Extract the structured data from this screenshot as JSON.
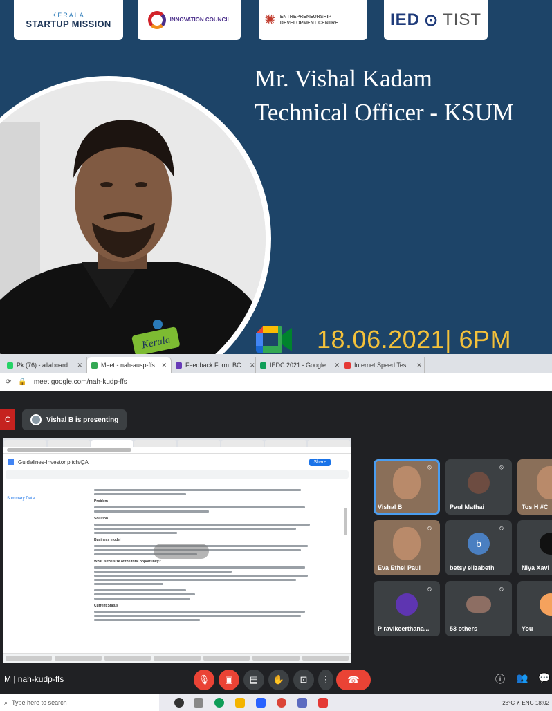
{
  "poster": {
    "logos": {
      "ksum_sub": "KERALA",
      "ksum_main": "STARTUP MISSION",
      "innovation": "INNOVATION COUNCIL",
      "innovation_sub": "",
      "edc": "ENTREPRENEURSHIP DEVELOPMENT CENTRE",
      "iedc_bold": "IED",
      "iedc_rest": "TIST"
    },
    "speaker_name": "Mr. Vishal Kadam",
    "speaker_role": "Technical Officer - KSUM",
    "shirt_label": "Kerala",
    "event_date": "18.06.2021| 6PM"
  },
  "browser": {
    "tabs": [
      {
        "label": "Pk (76) - allaboard",
        "active": false,
        "fav": "#25d366"
      },
      {
        "label": "Meet - nah-ausp-ffs",
        "active": true,
        "fav": "#34a853"
      },
      {
        "label": "Feedback Form: BC...",
        "active": false,
        "fav": "#673ab7"
      },
      {
        "label": "IEDC 2021 - Google...",
        "active": false,
        "fav": "#0f9d58"
      },
      {
        "label": "Internet Speed Test...",
        "active": false,
        "fav": "#e53935"
      }
    ],
    "url": "meet.google.com/nah-kudp-ffs"
  },
  "meet": {
    "presenting_label": "Vishal B is presenting",
    "red_chip": "C",
    "doc": {
      "title": "Guidelines-Investor pitch/QA",
      "share": "Share",
      "outline": "Summary Data",
      "sections": [
        "Problem",
        "Solution",
        "Business model",
        "What is the size of the total opportunity?",
        "Current Status"
      ]
    },
    "participants": [
      {
        "name": "Vishal B",
        "type": "photo",
        "speaking": true
      },
      {
        "name": "Paul Mathai",
        "type": "avatar",
        "color": "#6d4c41"
      },
      {
        "name": "Tos H #C",
        "type": "photo"
      },
      {
        "name": "Eva Ethel Paul",
        "type": "photo"
      },
      {
        "name": "betsy elizabeth",
        "type": "initial",
        "initial": "b",
        "color": "#4a7fc1"
      },
      {
        "name": "Niya Xavi",
        "type": "avatar",
        "color": "#111"
      },
      {
        "name": "P ravikeerthana...",
        "type": "avatar",
        "color": "#5e35b1"
      },
      {
        "name": "53 others",
        "type": "group"
      },
      {
        "name": "You",
        "type": "avatar",
        "color": "#f5a25d"
      }
    ],
    "meeting_code": "M | nah-kudp-ffs"
  },
  "taskbar": {
    "search_placeholder": "Type here to search",
    "tray_text": "28°C  ∧  ENG  18:02"
  }
}
